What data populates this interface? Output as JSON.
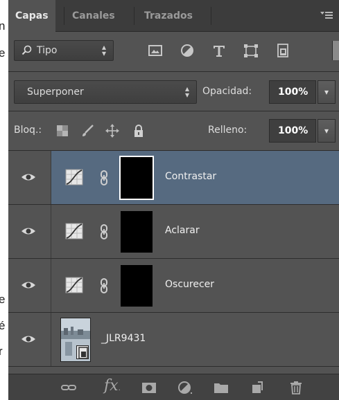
{
  "background_text": {
    "chars": [
      "n",
      "e",
      "e",
      "é",
      "r"
    ]
  },
  "tabs": [
    {
      "label": "Capas",
      "active": true
    },
    {
      "label": "Canales",
      "active": false
    },
    {
      "label": "Trazados",
      "active": false
    }
  ],
  "filter": {
    "kind_label": "Tipo",
    "icons": [
      "pixel-layer-filter-icon",
      "adjustment-layer-filter-icon",
      "type-layer-filter-icon",
      "shape-layer-filter-icon",
      "smart-object-filter-icon"
    ]
  },
  "blend": {
    "mode": "Superponer",
    "opacity_label": "Opacidad:",
    "opacity_value": "100%"
  },
  "lock": {
    "label": "Bloq.:",
    "fill_label": "Relleno:",
    "fill_value": "100%"
  },
  "layers": [
    {
      "name": "Contrastar",
      "type": "adjustment",
      "selected": true,
      "visible": true
    },
    {
      "name": "Aclarar",
      "type": "adjustment",
      "selected": false,
      "visible": true
    },
    {
      "name": "Oscurecer",
      "type": "adjustment",
      "selected": false,
      "visible": true
    },
    {
      "name": "_JLR9431",
      "type": "smart-object",
      "selected": false,
      "visible": true
    }
  ],
  "footer_icons": [
    "link-icon",
    "fx-icon",
    "mask-icon",
    "adjustment-icon",
    "folder-icon",
    "new-layer-icon",
    "trash-icon"
  ],
  "colors": {
    "panel_bg": "#535353",
    "selected_layer": "#566a80",
    "tab_bar": "#3c3c3c"
  }
}
